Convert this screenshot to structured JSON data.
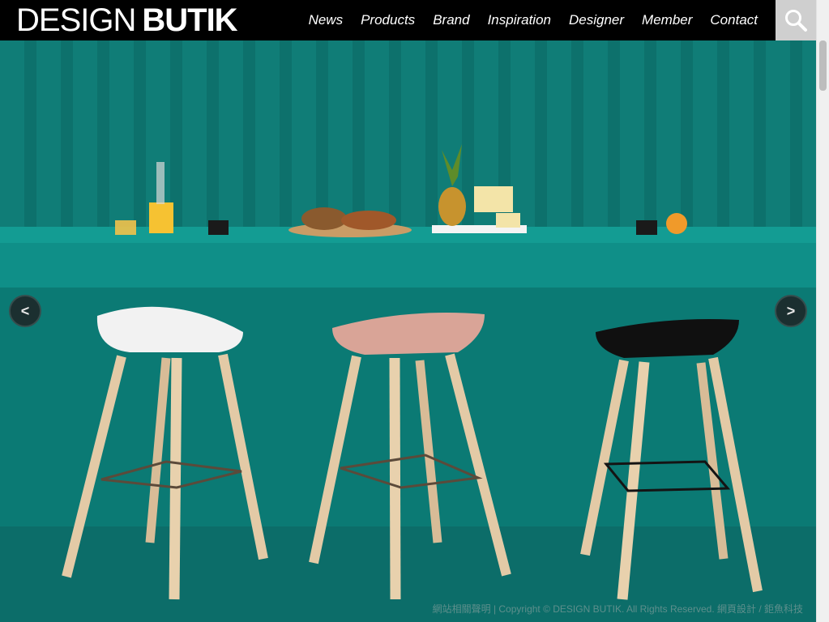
{
  "header": {
    "logo_light": "DESIGN",
    "logo_bold": "BUTIK",
    "nav": [
      "News",
      "Products",
      "Brand",
      "Inspiration",
      "Designer",
      "Member",
      "Contact"
    ],
    "search_icon": "search-icon"
  },
  "slider": {
    "prev_icon": "chevron-left-icon",
    "next_icon": "chevron-right-icon",
    "prev_label": "<",
    "next_label": ">"
  },
  "footer": {
    "text": "網站相關聲明 | Copyright © DESIGN BUTIK. All Rights Reserved. 網頁設計 / 鉅魚科技"
  },
  "colors": {
    "background": "#0e7f79",
    "topbar": "#000000",
    "accent": "#cfcfcf"
  }
}
